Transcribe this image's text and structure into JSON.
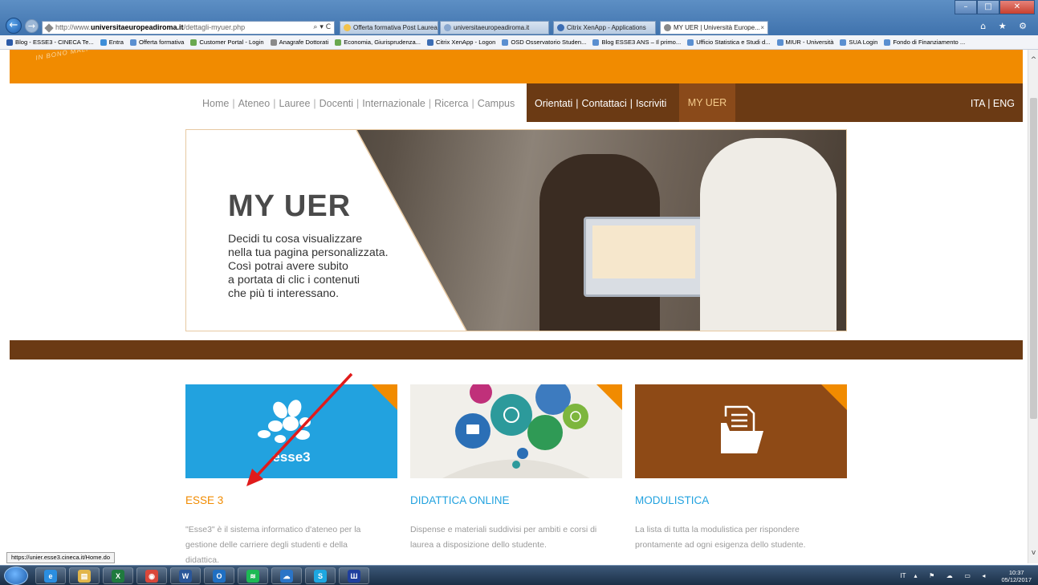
{
  "browser": {
    "address": {
      "prefix": "http://www.",
      "domain": "universitaeuropeadiroma.it",
      "path": "/dettagli-myuer.php",
      "tools": "⌕ ▾ C"
    },
    "tabs": [
      {
        "label": "Offerta formativa Post Laurea..."
      },
      {
        "label": "universitaeuropeadiroma.it"
      },
      {
        "label": "Citrix XenApp - Applications"
      },
      {
        "label": "MY UER | Università Europe...",
        "close": "×"
      }
    ],
    "window_buttons": {
      "minimize": "–",
      "maximize": "□",
      "close": "✕"
    },
    "toolbar_icons": "⌂ ★ ⚙",
    "favorites": [
      "Blog - ESSE3 - CINECA Te...",
      "Entra",
      "Offerta formativa",
      "Customer Portal - Login",
      "Anagrafe Dottorati",
      "Economia, Giurisprudenza...",
      "Citrix XenApp - Logon",
      "OSD Osservatorio Studen...",
      "Blog ESSE3 ANS – Il primo...",
      "Ufficio Statistica e Studi d...",
      "MIUR - Università",
      "SUA Login",
      "Fondo di Finanziamento ..."
    ]
  },
  "page": {
    "logo_text": "IN BONO MALI",
    "nav_left": [
      "Home",
      "Ateneo",
      "Lauree",
      "Docenti",
      "Internazionale",
      "Ricerca",
      "Campus"
    ],
    "nav_right": [
      "Orientati",
      "Contattaci",
      "Iscriviti"
    ],
    "nav_active": "MY UER",
    "lang": "ITA | ENG",
    "hero": {
      "title": "MY UER",
      "lines": [
        "Decidi tu cosa visualizzare",
        "nella tua pagina personalizzata.",
        "Così potrai avere subito",
        "a portata di clic i contenuti",
        "che più ti interessano."
      ]
    },
    "cards": [
      {
        "title": "ESSE 3",
        "logo_text": "esse3",
        "desc": [
          "\"Esse3\" è il sistema informatico d'ateneo per la",
          "gestione delle carriere degli studenti e della",
          "didattica."
        ]
      },
      {
        "title": "DIDATTICA ONLINE",
        "desc": [
          "Dispense e materiali suddivisi per ambiti e corsi di",
          "laurea a disposizione dello studente."
        ]
      },
      {
        "title": "MODULISTICA",
        "desc": [
          "La lista di tutta la modulistica per rispondere",
          "prontamente ad ogni esigenza dello studente."
        ]
      }
    ],
    "scroll_up": "^",
    "scroll_down": "v"
  },
  "status_url": "https://unier.esse3.cineca.it/Home.do",
  "taskbar": {
    "apps": [
      {
        "name": "ie-icon",
        "glyph": "e",
        "color": "#2b8ee0"
      },
      {
        "name": "file-explorer-icon",
        "glyph": "▤",
        "color": "#e2b64a"
      },
      {
        "name": "excel-icon",
        "glyph": "X",
        "color": "#1f7a3e"
      },
      {
        "name": "chrome-icon",
        "glyph": "◉",
        "color": "#d9473a"
      },
      {
        "name": "word-icon",
        "glyph": "W",
        "color": "#2a5699"
      },
      {
        "name": "outlook-icon",
        "glyph": "O",
        "color": "#1f6fc2"
      },
      {
        "name": "spotify-icon",
        "glyph": "≋",
        "color": "#1db954"
      },
      {
        "name": "onedrive-icon",
        "glyph": "☁",
        "color": "#2a74c7"
      },
      {
        "name": "skype-icon",
        "glyph": "S",
        "color": "#1ea7e1"
      },
      {
        "name": "institution-icon",
        "glyph": "Ш",
        "color": "#1f3f9e"
      }
    ],
    "tray_lang": "IT",
    "tray_icons": "▴ ⚑ ☁ ▭ ◂",
    "time": "10:37",
    "date": "05/12/2017"
  },
  "colors": {
    "orange": "#f18b00",
    "brown": "#6b3a14",
    "blue": "#22a2df",
    "arrow": "#e01b1b"
  }
}
